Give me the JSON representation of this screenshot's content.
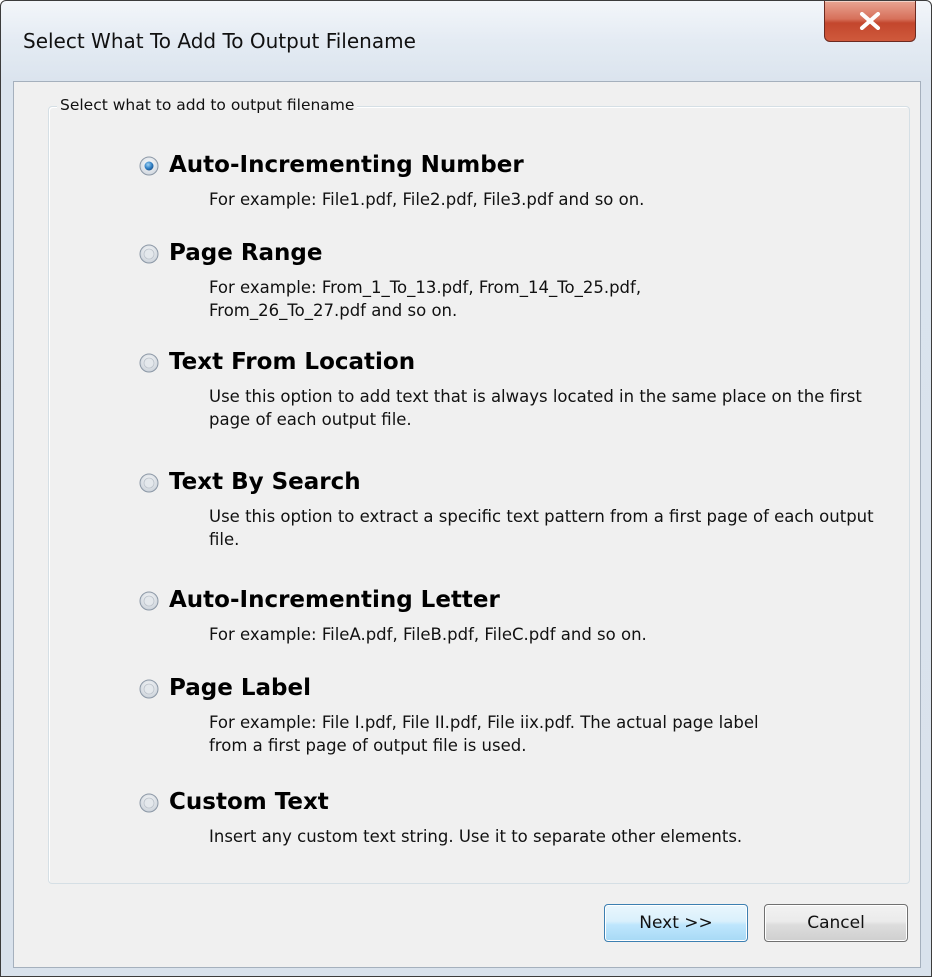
{
  "window": {
    "title": "Select What To Add To Output Filename",
    "close_label": "X"
  },
  "group": {
    "legend": "Select what to add to output filename"
  },
  "options": [
    {
      "title": "Auto-Incrementing Number",
      "description": "For example: File1.pdf, File2.pdf, File3.pdf and so on.",
      "selected": true
    },
    {
      "title": "Page Range",
      "description": "For example: From_1_To_13.pdf, From_14_To_25.pdf, From_26_To_27.pdf and so on.",
      "selected": false
    },
    {
      "title": "Text From Location",
      "description": "Use this option to add text that is always located in the same place on the first page of each output file.",
      "selected": false
    },
    {
      "title": "Text By Search",
      "description": "Use this option to extract a specific text pattern from a first page of each output file.",
      "selected": false
    },
    {
      "title": "Auto-Incrementing Letter",
      "description": "For example: FileA.pdf, FileB.pdf, FileC.pdf and so on.",
      "selected": false
    },
    {
      "title": "Page Label",
      "description": "For example: File I.pdf, File II.pdf, File iix.pdf. The actual page label from a first page of output file is used.",
      "selected": false
    },
    {
      "title": "Custom Text",
      "description": "Insert any custom text string. Use it to separate other elements.",
      "selected": false
    }
  ],
  "buttons": {
    "next": "Next >>",
    "cancel": "Cancel"
  },
  "colors": {
    "close_button": "#c94a30",
    "next_border": "#3c7fb1",
    "client_bg": "#f0f0f0"
  }
}
